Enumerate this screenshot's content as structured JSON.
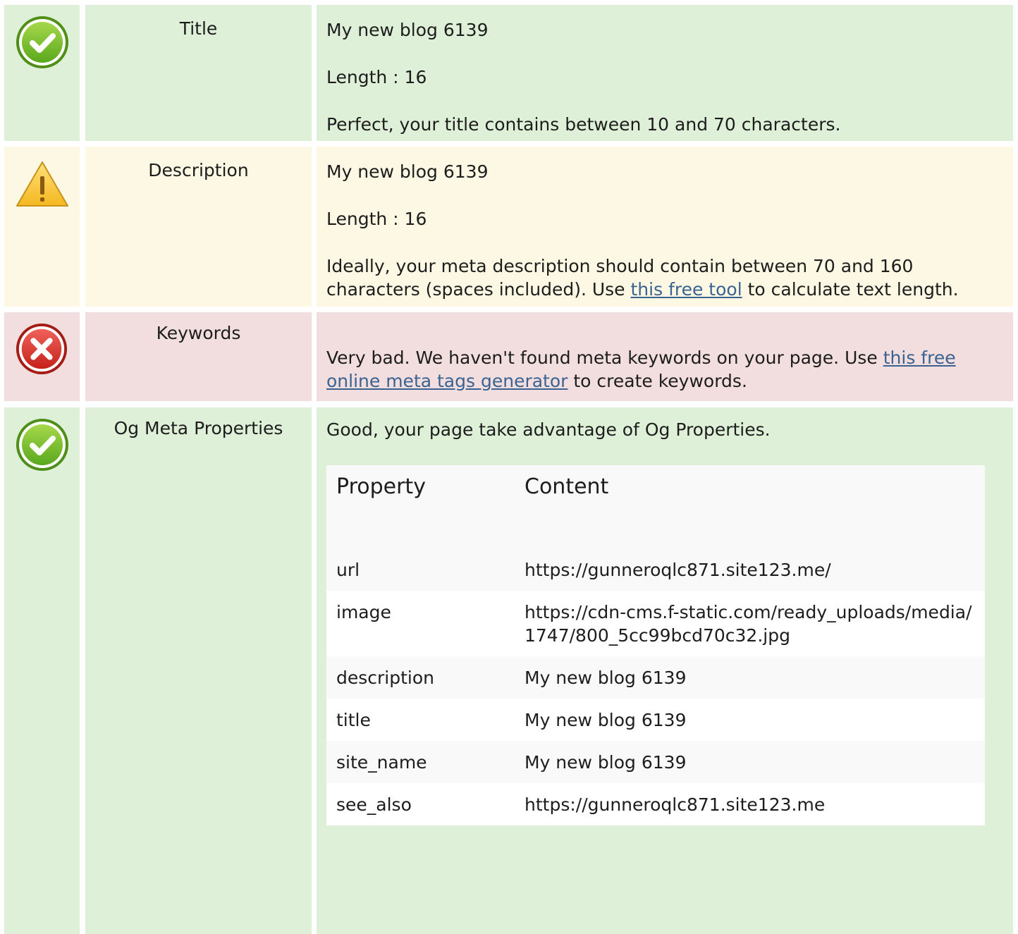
{
  "rows": [
    {
      "status": "good",
      "label": "Title",
      "value": "My new blog 6139",
      "length": "Length : 16",
      "message": "Perfect, your title contains between 10 and 70 characters."
    },
    {
      "status": "warn",
      "label": "Description",
      "value": "My new blog 6139",
      "length": "Length : 16",
      "message_pre": "Ideally, your meta description should contain between 70 and 160 characters (spaces included). Use ",
      "link": "this free tool",
      "message_post": " to calculate text length."
    },
    {
      "status": "bad",
      "label": "Keywords",
      "message_pre": "Very bad. We haven't found meta keywords on your page. Use ",
      "link": "this free online meta tags generator",
      "message_post": " to create keywords."
    },
    {
      "status": "good",
      "label": "Og Meta Properties",
      "message": "Good, your page take advantage of Og Properties.",
      "table": {
        "headers": [
          "Property",
          "Content"
        ],
        "rows": [
          [
            "url",
            "https://gunneroqlc871.site123.me/"
          ],
          [
            "image",
            "https://cdn-cms.f-static.com/ready_uploads/media/1747/800_5cc99bcd70c32.jpg"
          ],
          [
            "description",
            "My new blog 6139"
          ],
          [
            "title",
            "My new blog 6139"
          ],
          [
            "site_name",
            "My new blog 6139"
          ],
          [
            "see_also",
            "https://gunneroqlc871.site123.me"
          ]
        ]
      }
    }
  ],
  "colors": {
    "good": "#dff0d8",
    "warn": "#fcf8e3",
    "bad": "#f2dede",
    "link": "#3a6391"
  },
  "icons": [
    "check-circle-icon",
    "warning-triangle-icon",
    "error-circle-icon",
    "check-circle-icon"
  ]
}
